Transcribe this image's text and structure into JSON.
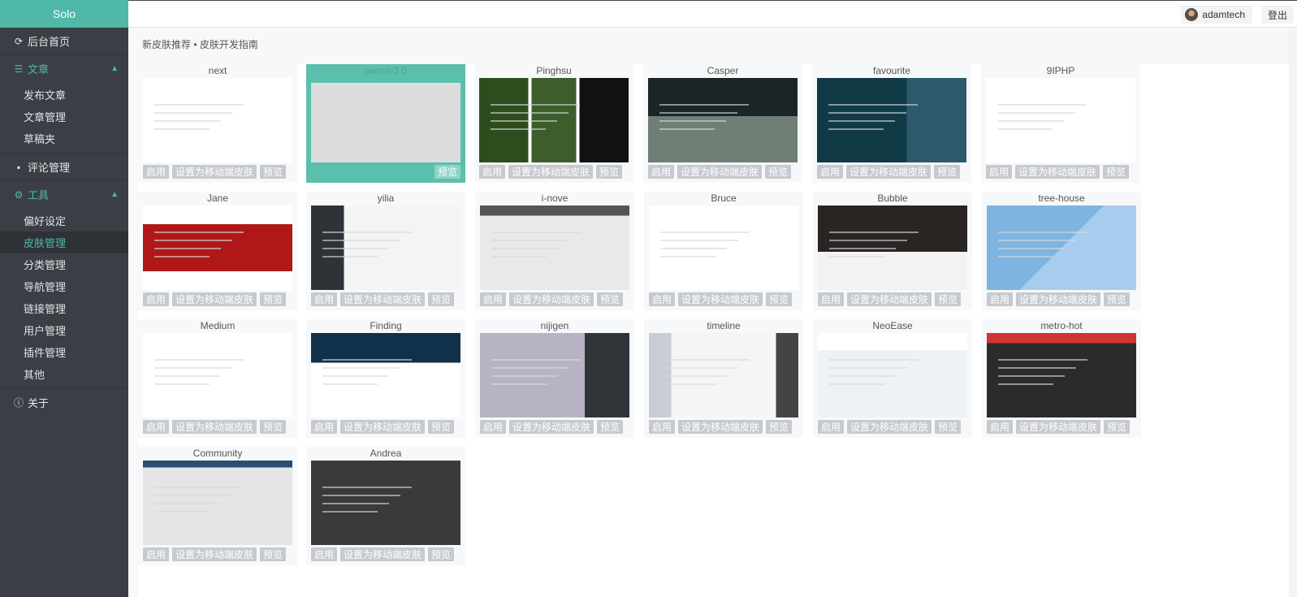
{
  "app": {
    "brand": "Solo"
  },
  "sidebar": {
    "home": "后台首页",
    "articles": {
      "label": "文章",
      "items": [
        "发布文章",
        "文章管理",
        "草稿夹"
      ]
    },
    "comments": "评论管理",
    "tools": {
      "label": "工具",
      "items": [
        "偏好设定",
        "皮肤管理",
        "分类管理",
        "导航管理",
        "链接管理",
        "用户管理",
        "插件管理",
        "其他"
      ]
    },
    "about": "关于"
  },
  "header": {
    "username": "adamtech",
    "logout": "登出"
  },
  "breadcrumb": "新皮肤推荐 • 皮肤开发指南",
  "buttons": {
    "enable": "启用",
    "set_mobile": "设置为移动端皮肤",
    "preview": "预览"
  },
  "skins": [
    {
      "name": "next"
    },
    {
      "name": "owmx-3.0",
      "current": true
    },
    {
      "name": "Pinghsu"
    },
    {
      "name": "Casper"
    },
    {
      "name": "favourite"
    },
    {
      "name": "9IPHP"
    },
    {
      "name": "Jane"
    },
    {
      "name": "yilia"
    },
    {
      "name": "i-nove"
    },
    {
      "name": "Bruce"
    },
    {
      "name": "Bubble"
    },
    {
      "name": "tree-house"
    },
    {
      "name": "Medium"
    },
    {
      "name": "Finding"
    },
    {
      "name": "nijigen"
    },
    {
      "name": "timeline"
    },
    {
      "name": "NeoEase"
    },
    {
      "name": "metro-hot"
    },
    {
      "name": "Community"
    },
    {
      "name": "Andrea"
    }
  ]
}
